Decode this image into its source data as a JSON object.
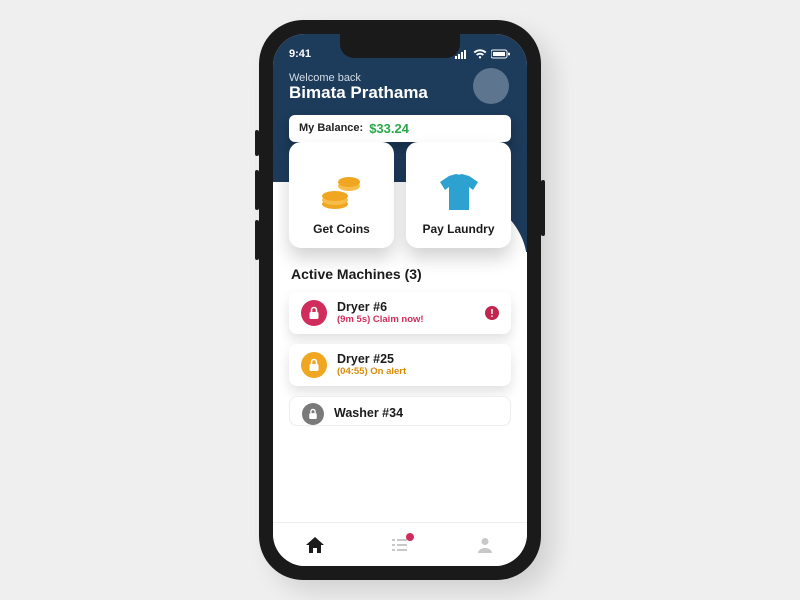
{
  "status": {
    "time": "9:41"
  },
  "header": {
    "welcome": "Welcome back",
    "username": "Bimata Prathama"
  },
  "balance": {
    "label": "My Balance:",
    "amount": "$33.24"
  },
  "actions": {
    "get_coins": "Get Coins",
    "pay_laundry": "Pay Laundry"
  },
  "machines": {
    "title": "Active Machines (3)",
    "items": [
      {
        "name": "Dryer #6",
        "sub": "(9m 5s) Claim now!",
        "color": "red",
        "alert": true
      },
      {
        "name": "Dryer #25",
        "sub": "(04:55) On alert",
        "color": "amber",
        "alert": false
      },
      {
        "name": "Washer #34",
        "sub": "",
        "color": "grey",
        "alert": false
      }
    ]
  },
  "colors": {
    "header_bg": "#1d3b5b",
    "accent_green": "#2ba84a",
    "accent_red": "#d12d5c",
    "accent_amber": "#f0a621"
  }
}
